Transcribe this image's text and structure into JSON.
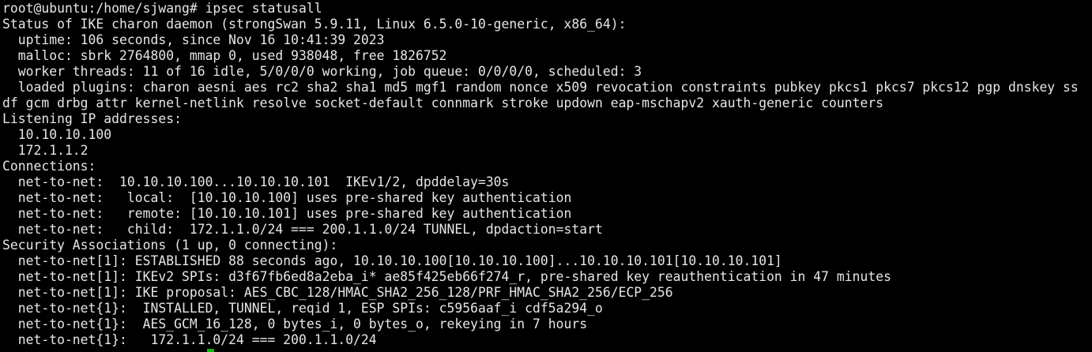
{
  "terminal": {
    "background": "#000000",
    "foreground": "#e6e6e6",
    "cursor_color": "#00c000",
    "lines": [
      "root@ubuntu:/home/sjwang# ipsec statusall",
      "Status of IKE charon daemon (strongSwan 5.9.11, Linux 6.5.0-10-generic, x86_64):",
      "  uptime: 106 seconds, since Nov 16 10:41:39 2023",
      "  malloc: sbrk 2764800, mmap 0, used 938048, free 1826752",
      "  worker threads: 11 of 16 idle, 5/0/0/0 working, job queue: 0/0/0/0, scheduled: 3",
      "  loaded plugins: charon aesni aes rc2 sha2 sha1 md5 mgf1 random nonce x509 revocation constraints pubkey pkcs1 pkcs7 pkcs12 pgp dnskey ss",
      "df gcm drbg attr kernel-netlink resolve socket-default connmark stroke updown eap-mschapv2 xauth-generic counters",
      "Listening IP addresses:",
      "  10.10.10.100",
      "  172.1.1.2",
      "Connections:",
      "  net-to-net:  10.10.10.100...10.10.10.101  IKEv1/2, dpddelay=30s",
      "  net-to-net:   local:  [10.10.10.100] uses pre-shared key authentication",
      "  net-to-net:   remote: [10.10.10.101] uses pre-shared key authentication",
      "  net-to-net:   child:  172.1.1.0/24 === 200.1.1.0/24 TUNNEL, dpdaction=start",
      "Security Associations (1 up, 0 connecting):",
      "  net-to-net[1]: ESTABLISHED 88 seconds ago, 10.10.10.100[10.10.10.100]...10.10.10.101[10.10.10.101]",
      "  net-to-net[1]: IKEv2 SPIs: d3f67fb6ed8a2eba_i* ae85f425eb66f274_r, pre-shared key reauthentication in 47 minutes",
      "  net-to-net[1]: IKE proposal: AES_CBC_128/HMAC_SHA2_256_128/PRF_HMAC_SHA2_256/ECP_256",
      "  net-to-net{1}:  INSTALLED, TUNNEL, reqid 1, ESP SPIs: c5956aaf_i cdf5a294_o",
      "  net-to-net{1}:  AES_GCM_16_128, 0 bytes_i, 0 bytes_o, rekeying in 7 hours",
      "  net-to-net{1}:   172.1.1.0/24 === 200.1.1.0/24"
    ]
  }
}
